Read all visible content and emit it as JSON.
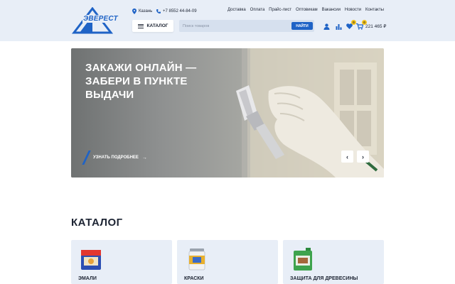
{
  "header": {
    "logo": {
      "text": "ЭВЕРЕСТ"
    },
    "city": "Казань",
    "phone": "+7 8552 44-84-09",
    "nav": [
      "Доставка",
      "Оплата",
      "Прайс-лист",
      "Оптовикам",
      "Вакансии",
      "Новости",
      "Контакты"
    ],
    "catalog_button": "КАТАЛОГ",
    "search": {
      "placeholder": "Поиск товаров",
      "button": "НАЙТИ"
    },
    "favorites_count": "0",
    "cart_count": "0",
    "cart_sum": "221 465 ₽"
  },
  "banner": {
    "title": "ЗАКАЖИ ОНЛАЙН — ЗАБЕРИ В ПУНКТЕ ВЫДАЧИ",
    "link": "УЗНАТЬ ПОДРОБНЕЕ",
    "prev_arrow": "‹",
    "next_arrow": "›"
  },
  "catalog": {
    "title": "КАТАЛОГ",
    "cards": [
      {
        "label": "ЭМАЛИ"
      },
      {
        "label": "КРАСКИ"
      },
      {
        "label": "ЗАЩИТА ДЛЯ ДРЕВЕСИНЫ"
      }
    ]
  },
  "colors": {
    "accent": "#1f63c6",
    "header_bg": "#e8eef7",
    "badge": "#f3c218",
    "text": "#1d2433"
  }
}
